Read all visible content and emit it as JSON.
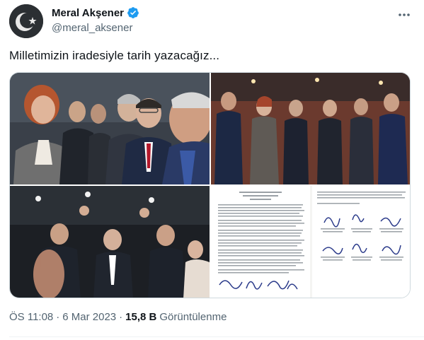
{
  "author": {
    "display_name": "Meral Akşener",
    "handle": "@meral_aksener",
    "avatar_icon": "crescent-star-logo",
    "verified_icon": "verified-badge-icon",
    "verified_color": "#1d9bf0"
  },
  "more_icon": "ellipsis-icon",
  "tweet": {
    "text": "Milletimizin iradesiyle tarih yazacağız..."
  },
  "media": [
    {
      "description_icon": "photo-leaders-group"
    },
    {
      "description_icon": "photo-leaders-lineup"
    },
    {
      "description_icon": "photo-leaders-celebrating"
    },
    {
      "description_icon": "photo-signed-document"
    }
  ],
  "meta": {
    "time": "ÖS 11:08",
    "separator": "·",
    "date": "6 Mar 2023",
    "views_count": "15,8 B",
    "views_label": "Görüntülenme"
  },
  "colors": {
    "text_primary": "#0f1419",
    "text_secondary": "#536471",
    "border": "#cfd9de"
  }
}
